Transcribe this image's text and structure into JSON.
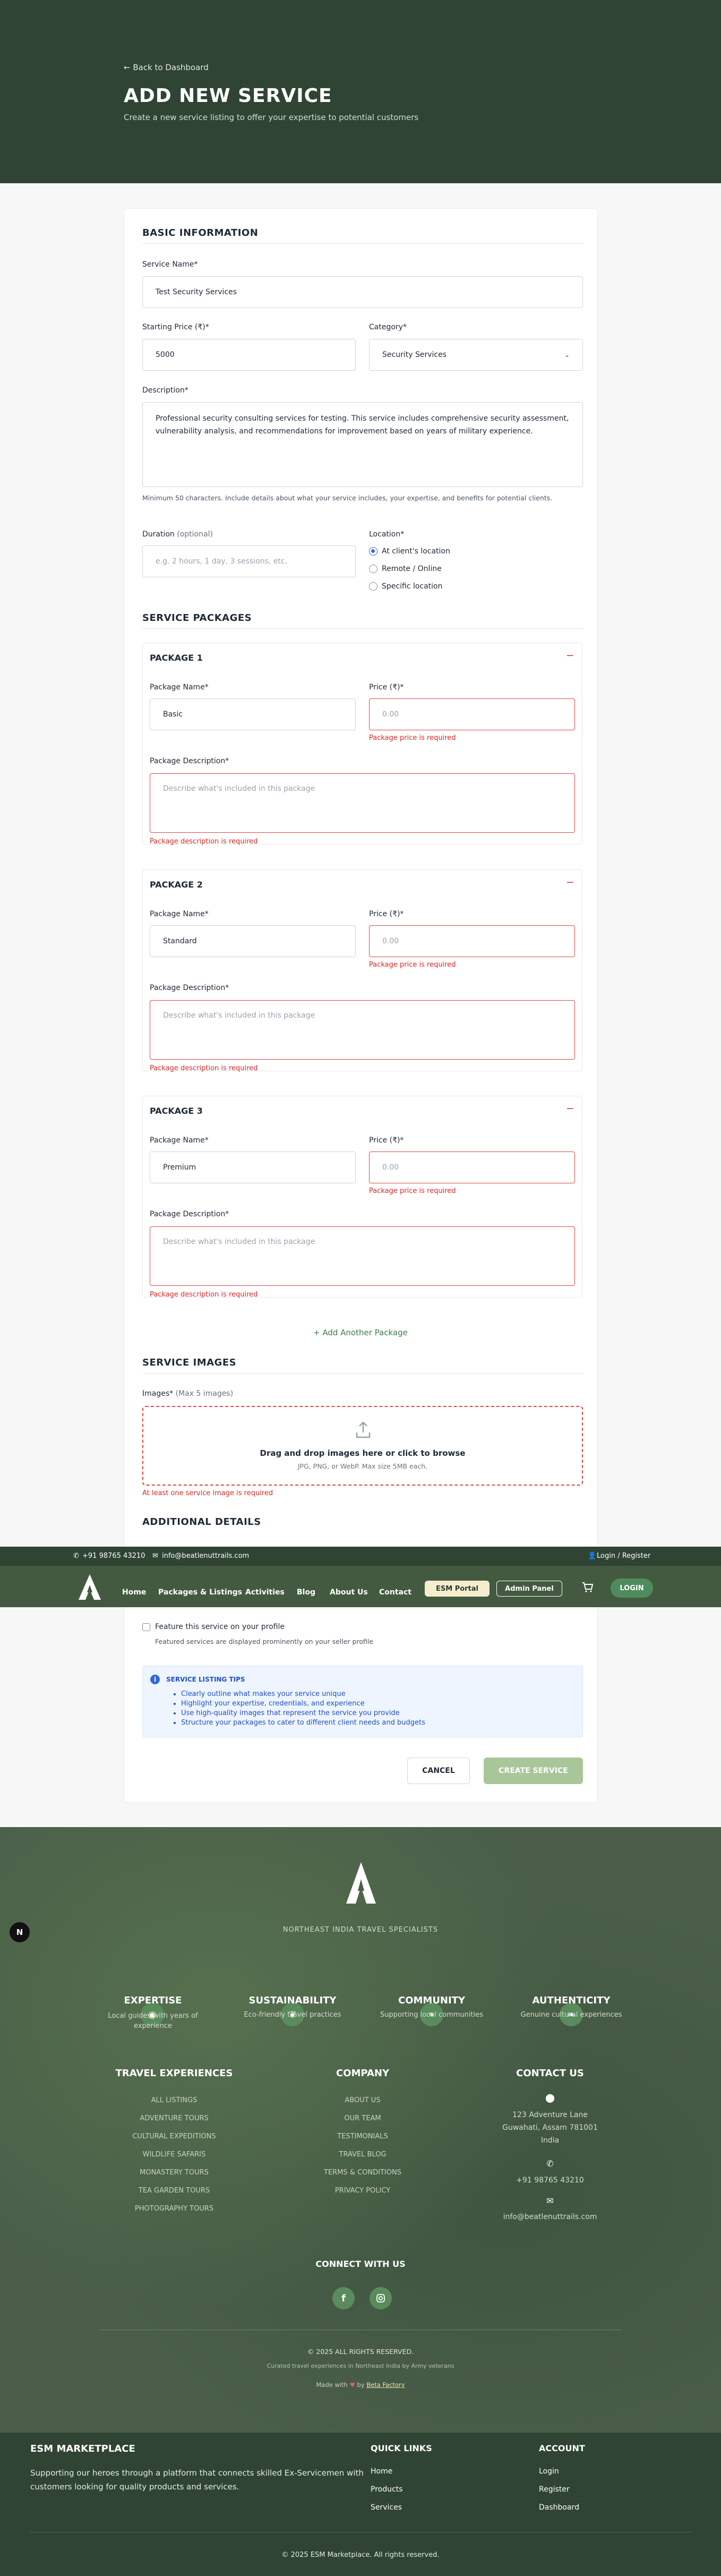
{
  "hero": {
    "back_label": "← Back to Dashboard",
    "title": "ADD NEW SERVICE",
    "subtitle": "Create a new service listing to offer your expertise to potential customers"
  },
  "basic": {
    "section_title": "BASIC INFORMATION",
    "service_name_label": "Service Name*",
    "service_name_value": "Test Security Services",
    "price_label": "Starting Price (₹)*",
    "price_value": "5000",
    "category_label": "Category*",
    "category_value": "Security Services",
    "description_label": "Description*",
    "description_value": "Professional security consulting services for testing. This service includes comprehensive security assessment, vulnerability analysis, and recommendations for improvement based on years of military experience.",
    "description_help": "Minimum 50 characters. Include details about what your service includes, your expertise, and benefits for potential clients.",
    "duration_label": "Duration",
    "duration_optional": "(optional)",
    "duration_placeholder": "e.g. 2 hours, 1 day, 3 sessions, etc.",
    "location_label": "Location*",
    "location_options": [
      "At client's location",
      "Remote / Online",
      "Specific location"
    ]
  },
  "packages": {
    "section_title": "SERVICE PACKAGES",
    "name_label": "Package Name*",
    "price_label": "Price (₹)*",
    "desc_label": "Package Description*",
    "price_placeholder": "0.00",
    "desc_placeholder": "Describe what's included in this package",
    "price_error": "Package price is required",
    "desc_error": "Package description is required",
    "items": [
      {
        "title": "PACKAGE 1",
        "name": "Basic"
      },
      {
        "title": "PACKAGE 2",
        "name": "Standard"
      },
      {
        "title": "PACKAGE 3",
        "name": "Premium"
      }
    ],
    "collapse_icon": "−",
    "add_label": "+ Add Another Package"
  },
  "images": {
    "section_title": "SERVICE IMAGES",
    "label": "Images*",
    "label_note": "(Max 5 images)",
    "drop_title": "Drag and drop images here or click to browse",
    "drop_sub": "JPG, PNG, or WebP. Max size 5MB each.",
    "error": "At least one service image is required"
  },
  "additional": {
    "section_title": "ADDITIONAL DETAILS",
    "feature_label": "Feature this service on your profile",
    "feature_help": "Featured services are displayed prominently on your seller profile",
    "tips_title": "SERVICE LISTING TIPS",
    "tips": [
      "Clearly outline what makes your service unique",
      "Highlight your expertise, credentials, and experience",
      "Use high-quality images that represent the service you provide",
      "Structure your packages to cater to different client needs and budgets"
    ],
    "cancel_label": "CANCEL",
    "create_label": "CREATE SERVICE"
  },
  "topbar": {
    "phone": "+91 98765 43210",
    "email": "info@beatlenuttrails.com",
    "login": "Login / Register"
  },
  "nav": {
    "items": [
      "Home",
      "Packages & Listings",
      "Activities",
      "Blog",
      "About Us",
      "Contact"
    ],
    "esm_portal": "ESM Portal",
    "admin_panel": "Admin Panel",
    "login": "LOGIN"
  },
  "footer": {
    "tagline": "NORTHEAST INDIA TRAVEL SPECIALISTS",
    "features": [
      {
        "title": "EXPERTISE",
        "desc": "Local guides with years of experience"
      },
      {
        "title": "SUSTAINABILITY",
        "desc": "Eco-friendly travel practices"
      },
      {
        "title": "COMMUNITY",
        "desc": "Supporting local communities"
      },
      {
        "title": "AUTHENTICITY",
        "desc": "Genuine cultural experiences"
      }
    ],
    "travel_title": "TRAVEL EXPERIENCES",
    "travel_links": [
      "ALL LISTINGS",
      "ADVENTURE TOURS",
      "CULTURAL EXPEDITIONS",
      "WILDLIFE SAFARIS",
      "MONASTERY TOURS",
      "TEA GARDEN TOURS",
      "PHOTOGRAPHY TOURS"
    ],
    "company_title": "COMPANY",
    "company_links": [
      "ABOUT US",
      "OUR TEAM",
      "TESTIMONIALS",
      "TRAVEL BLOG",
      "TERMS & CONDITIONS",
      "PRIVACY POLICY"
    ],
    "contact_title": "CONTACT US",
    "address_1": "123 Adventure Lane",
    "address_2": "Guwahati, Assam 781001",
    "address_3": "India",
    "phone": "+91 98765 43210",
    "email": "info@beatlenuttrails.com",
    "connect_title": "CONNECT WITH US",
    "copyright": "© 2025 ALL RIGHTS RESERVED.",
    "curated": "Curated travel experiences in Northeast India by Army veterans",
    "made_with": "Made with",
    "made_by": "by",
    "maker": "Beta Factory"
  },
  "esm_footer": {
    "title": "ESM MARKETPLACE",
    "desc": "Supporting our heroes through a platform that connects skilled Ex-Servicemen with customers looking for quality products and services.",
    "quick_title": "QUICK LINKS",
    "quick_links": [
      "Home",
      "Products",
      "Services"
    ],
    "account_title": "ACCOUNT",
    "account_links": [
      "Login",
      "Register",
      "Dashboard"
    ],
    "copyright": "© 2025 ESM Marketplace. All rights reserved."
  }
}
